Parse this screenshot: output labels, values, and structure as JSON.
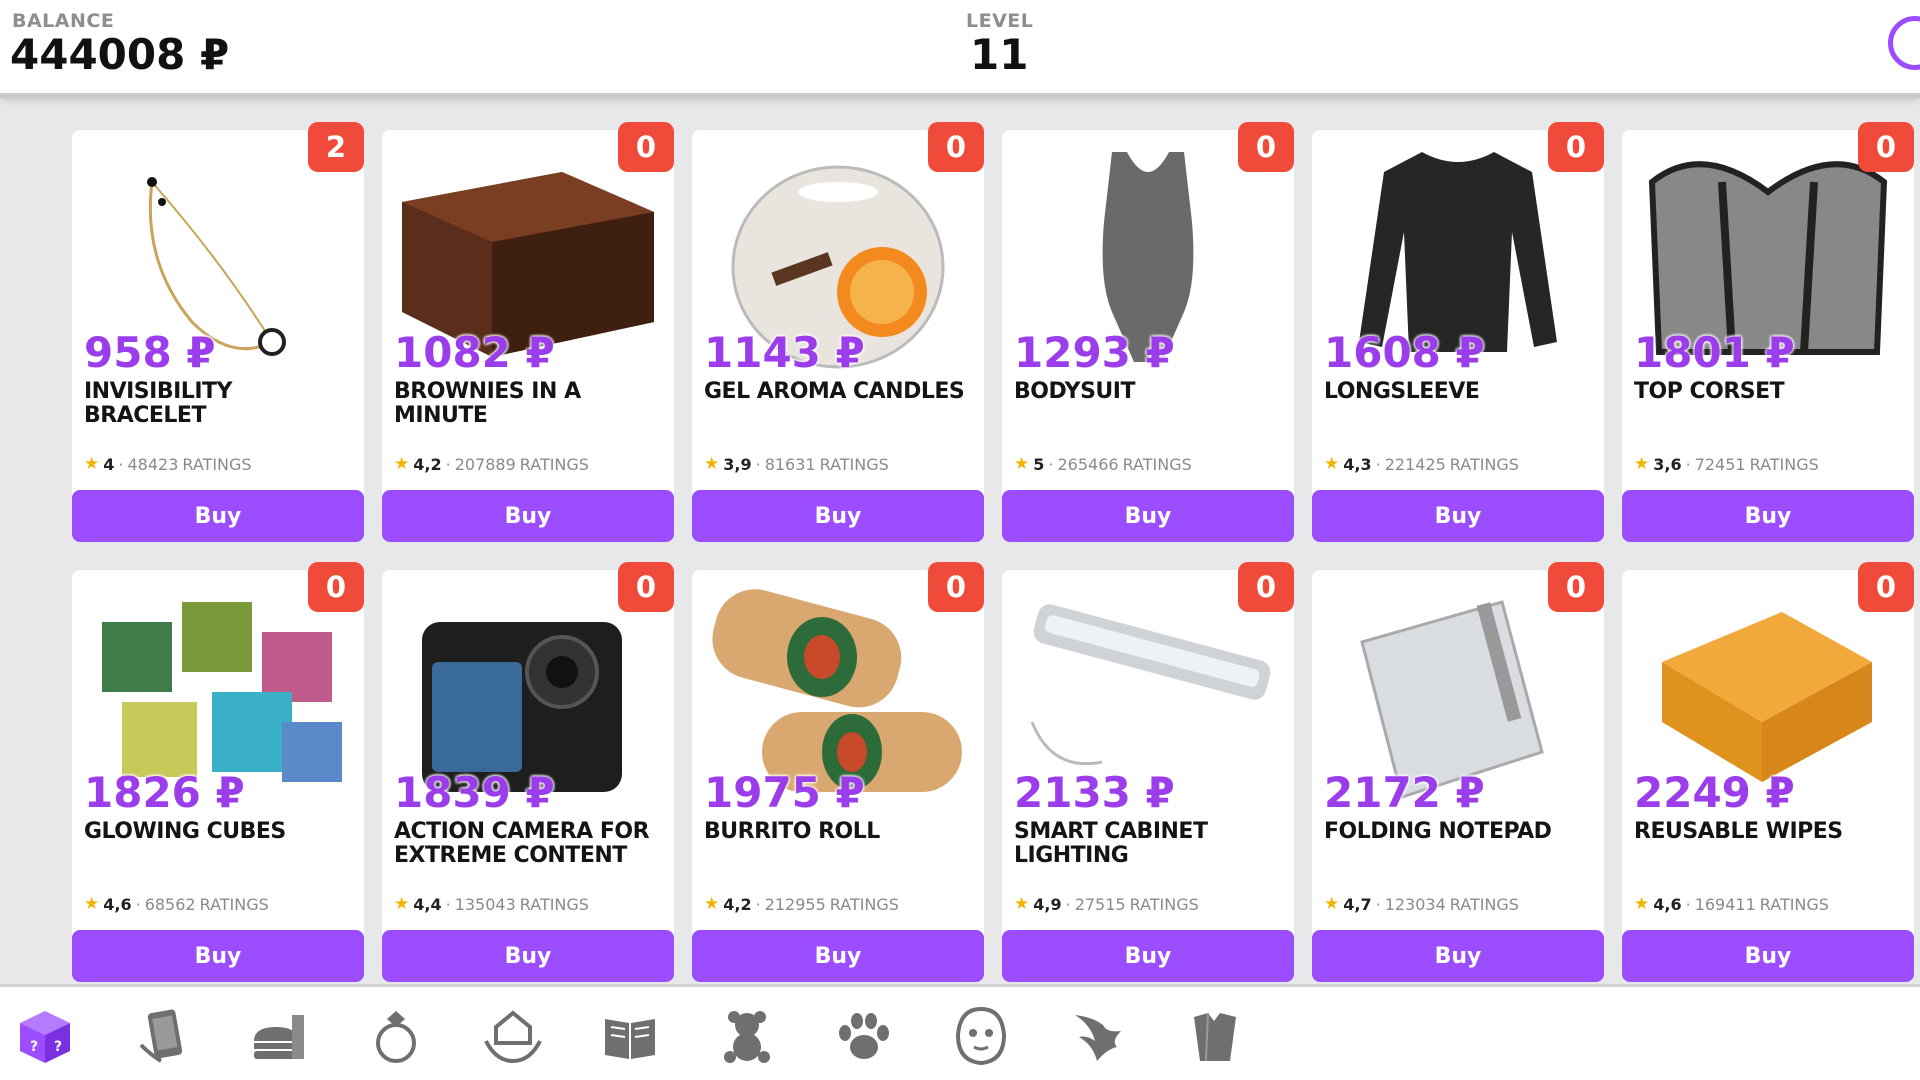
{
  "header": {
    "balance_caption": "BALANCE",
    "balance_value": "444008 ₽",
    "level_caption": "LEVEL",
    "level_value": "11"
  },
  "buy_label": "Buy",
  "ratings_suffix": "RATINGS",
  "products": [
    {
      "price": "958 ₽",
      "name": "Invisibility bracelet",
      "rating": "4",
      "ratings_count": "48423",
      "badge": "2",
      "icon": "bracelet-icon"
    },
    {
      "price": "1082 ₽",
      "name": "Brownies in a minute",
      "rating": "4,2",
      "ratings_count": "207889",
      "badge": "0",
      "icon": "brownie-icon"
    },
    {
      "price": "1143 ₽",
      "name": "Gel aroma candles",
      "rating": "3,9",
      "ratings_count": "81631",
      "badge": "0",
      "icon": "candle-icon"
    },
    {
      "price": "1293 ₽",
      "name": "Bodysuit",
      "rating": "5",
      "ratings_count": "265466",
      "badge": "0",
      "icon": "bodysuit-icon"
    },
    {
      "price": "1608 ₽",
      "name": "Longsleeve",
      "rating": "4,3",
      "ratings_count": "221425",
      "badge": "0",
      "icon": "longsleeve-icon"
    },
    {
      "price": "1801 ₽",
      "name": "Top corset",
      "rating": "3,6",
      "ratings_count": "72451",
      "badge": "0",
      "icon": "corset-icon"
    },
    {
      "price": "1826 ₽",
      "name": "Glowing cubes",
      "rating": "4,6",
      "ratings_count": "68562",
      "badge": "0",
      "icon": "glowing-cubes-icon"
    },
    {
      "price": "1839 ₽",
      "name": "Action camera for extreme content",
      "rating": "4,4",
      "ratings_count": "135043",
      "badge": "0",
      "icon": "action-camera-icon"
    },
    {
      "price": "1975 ₽",
      "name": "Burrito roll",
      "rating": "4,2",
      "ratings_count": "212955",
      "badge": "0",
      "icon": "burrito-icon"
    },
    {
      "price": "2133 ₽",
      "name": "Smart cabinet lighting",
      "rating": "4,9",
      "ratings_count": "27515",
      "badge": "0",
      "icon": "led-bar-icon"
    },
    {
      "price": "2172 ₽",
      "name": "Folding notepad",
      "rating": "4,7",
      "ratings_count": "123034",
      "badge": "0",
      "icon": "notepad-icon"
    },
    {
      "price": "2249 ₽",
      "name": "Reusable wipes",
      "rating": "4,6",
      "ratings_count": "169411",
      "badge": "0",
      "icon": "wipes-icon"
    }
  ],
  "nav": [
    {
      "icon": "mystery-box-icon",
      "active": true
    },
    {
      "icon": "phone-icon",
      "active": false
    },
    {
      "icon": "fast-food-icon",
      "active": false
    },
    {
      "icon": "ring-icon",
      "active": false
    },
    {
      "icon": "home-care-icon",
      "active": false
    },
    {
      "icon": "book-icon",
      "active": false
    },
    {
      "icon": "teddy-bear-icon",
      "active": false
    },
    {
      "icon": "paw-icon",
      "active": false
    },
    {
      "icon": "face-mask-icon",
      "active": false
    },
    {
      "icon": "phoenix-icon",
      "active": false
    },
    {
      "icon": "clothes-icon",
      "active": false
    }
  ],
  "colors": {
    "accent": "#9b4dff",
    "price": "#9b3dea",
    "badge": "#f04a3a",
    "star": "#f5b301"
  }
}
